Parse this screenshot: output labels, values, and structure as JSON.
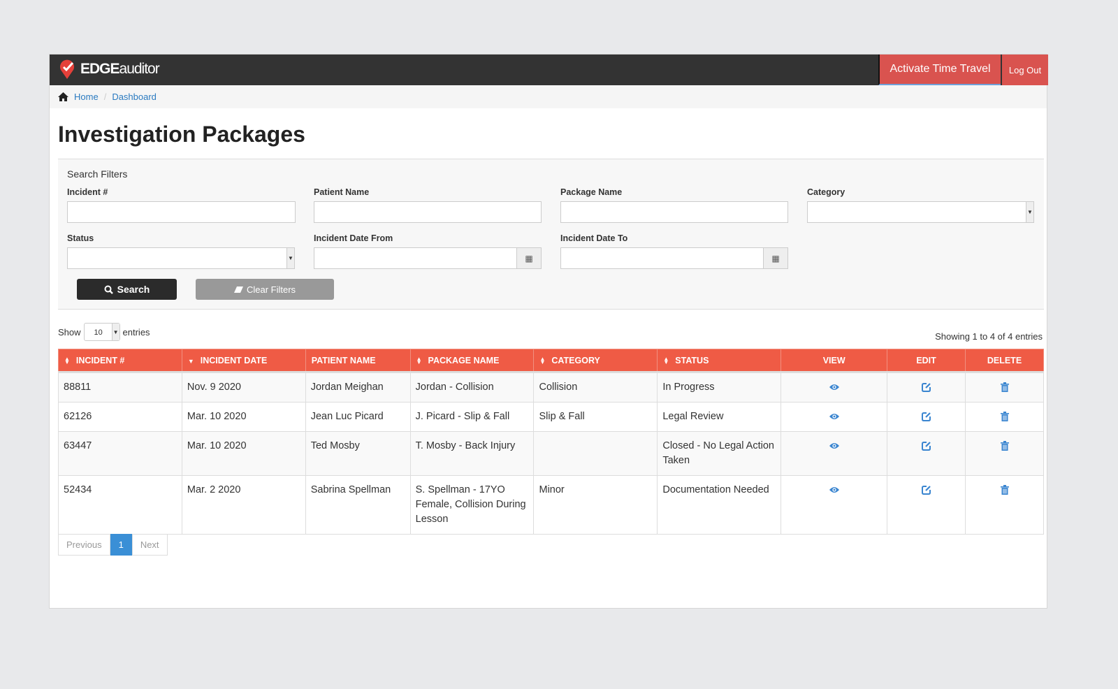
{
  "app": {
    "brand_bold": "EDGE",
    "brand_light": "auditor",
    "activate_label": "Activate Time Travel",
    "logout_label": "Log Out"
  },
  "breadcrumb": [
    "Home",
    "Dashboard"
  ],
  "page_title": "Investigation Packages",
  "filters": {
    "title": "Search Filters",
    "incident_label": "Incident #",
    "patient_label": "Patient Name",
    "package_label": "Package Name",
    "category_label": "Category",
    "status_label": "Status",
    "date_from_label": "Incident Date From",
    "date_to_label": "Incident Date To",
    "search_label": "Search",
    "clear_label": "Clear Filters"
  },
  "table_controls": {
    "show": "Show",
    "page_length": "10",
    "entries": "entries",
    "info": "Showing 1 to 4 of 4 entries"
  },
  "columns": [
    "INCIDENT #",
    "INCIDENT DATE",
    "PATIENT NAME",
    "PACKAGE NAME",
    "CATEGORY",
    "STATUS",
    "VIEW",
    "EDIT",
    "DELETE"
  ],
  "rows": [
    [
      "88811",
      "Nov. 9 2020",
      "Jordan Meighan",
      "Jordan - Collision",
      "Collision",
      "In Progress"
    ],
    [
      "62126",
      "Mar. 10 2020",
      "Jean Luc Picard",
      "J. Picard - Slip & Fall",
      "Slip & Fall",
      "Legal Review"
    ],
    [
      "63447",
      "Mar. 10 2020",
      "Ted Mosby",
      "T. Mosby - Back Injury",
      "",
      "Closed - No Legal Action Taken"
    ],
    [
      "52434",
      "Mar. 2 2020",
      "Sabrina Spellman",
      "S. Spellman - 17YO Female, Collision During Lesson",
      "Minor",
      "Documentation Needed"
    ]
  ],
  "pagination": {
    "previous": "Previous",
    "current": "1",
    "next": "Next"
  },
  "colors": {
    "navbar": "#333333",
    "accent_red": "#d9534f",
    "table_header": "#ef5b45",
    "link": "#2a7ac0"
  }
}
